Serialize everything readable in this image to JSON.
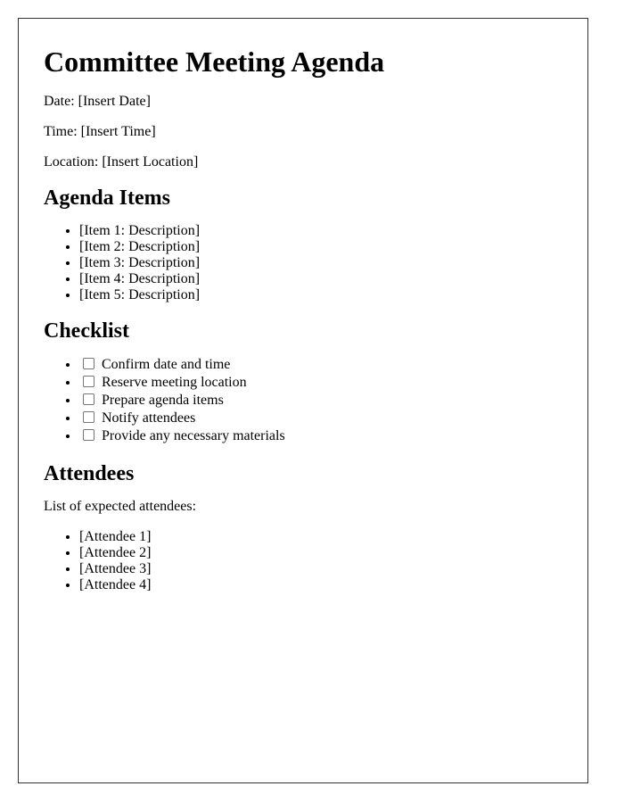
{
  "title": "Committee Meeting Agenda",
  "meta": {
    "date": "Date: [Insert Date]",
    "time": "Time: [Insert Time]",
    "location": "Location: [Insert Location]"
  },
  "agenda": {
    "heading": "Agenda Items",
    "items": [
      "[Item 1: Description]",
      "[Item 2: Description]",
      "[Item 3: Description]",
      "[Item 4: Description]",
      "[Item 5: Description]"
    ]
  },
  "checklist": {
    "heading": "Checklist",
    "items": [
      {
        "label": "Confirm date and time",
        "checked": false
      },
      {
        "label": "Reserve meeting location",
        "checked": false
      },
      {
        "label": "Prepare agenda items",
        "checked": false
      },
      {
        "label": "Notify attendees",
        "checked": false
      },
      {
        "label": "Provide any necessary materials",
        "checked": false
      }
    ]
  },
  "attendees": {
    "heading": "Attendees",
    "intro": "List of expected attendees:",
    "items": [
      "[Attendee 1]",
      "[Attendee 2]",
      "[Attendee 3]",
      "[Attendee 4]"
    ]
  }
}
